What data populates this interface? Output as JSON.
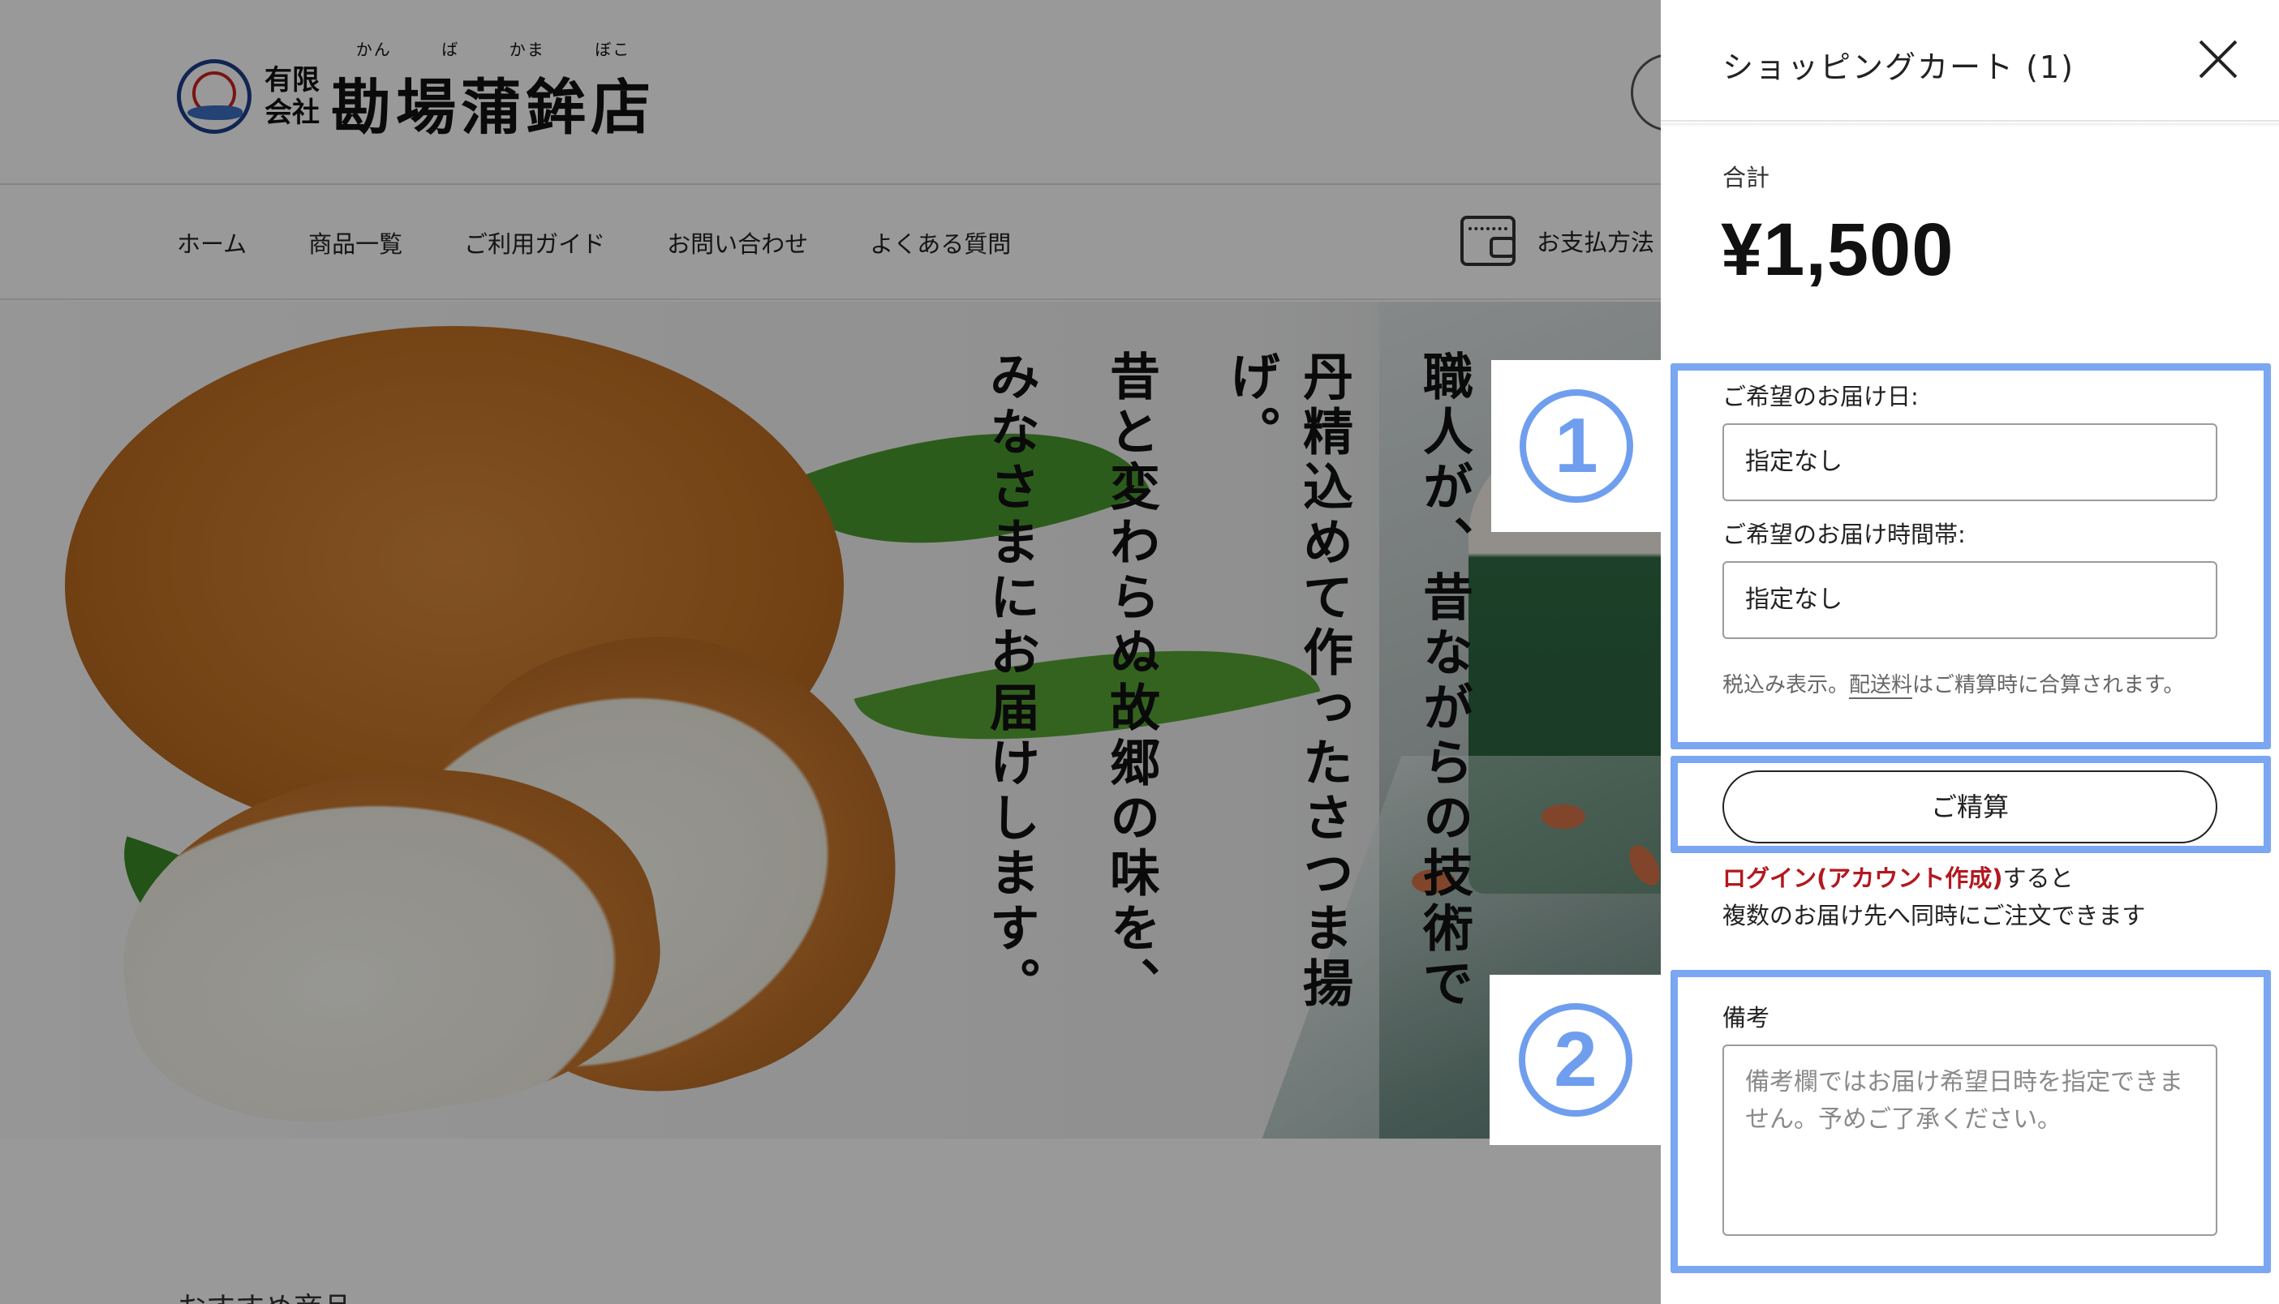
{
  "site": {
    "logo": {
      "company_line1": "有限",
      "company_line2": "会社",
      "name": "勘場蒲鉾店",
      "ruby": [
        "かん",
        "ば",
        "かま",
        "ぼこ"
      ]
    },
    "nav": {
      "items": [
        "ホーム",
        "商品一覧",
        "ご利用ガイド",
        "お問い合わせ",
        "よくある質問"
      ],
      "payment_label": "お支払方法"
    },
    "hero": {
      "copy_lines": [
        "職人が、昔ながらの技術で",
        "丹精込めて作ったさつま揚げ。",
        "昔と変わらぬ故郷の味を、",
        "みなさまにお届けします。"
      ]
    },
    "section_heading_partial": "おすすめ商品"
  },
  "cart": {
    "title": "ショッピングカート (1)",
    "total_label": "合計",
    "total_value": "¥1,500",
    "delivery_date_label": "ご希望のお届け日:",
    "delivery_date_value": "指定なし",
    "delivery_time_label": "ご希望のお届け時間帯:",
    "delivery_time_value": "指定なし",
    "tax_note_prefix": "税込み表示。",
    "tax_note_link": "配送料",
    "tax_note_suffix": "はご精算時に合算されます。",
    "checkout_label": "ご精算",
    "login_link": "ログイン(アカウント作成)",
    "login_suffix": "すると",
    "login_line2": "複数のお届け先へ同時にご注文できます",
    "memo_label": "備考",
    "memo_placeholder": "備考欄ではお届け希望日時を指定できません。予めご了承ください。"
  },
  "annotations": {
    "badge1": "1",
    "badge2": "2",
    "color": "#7ba6f2"
  }
}
